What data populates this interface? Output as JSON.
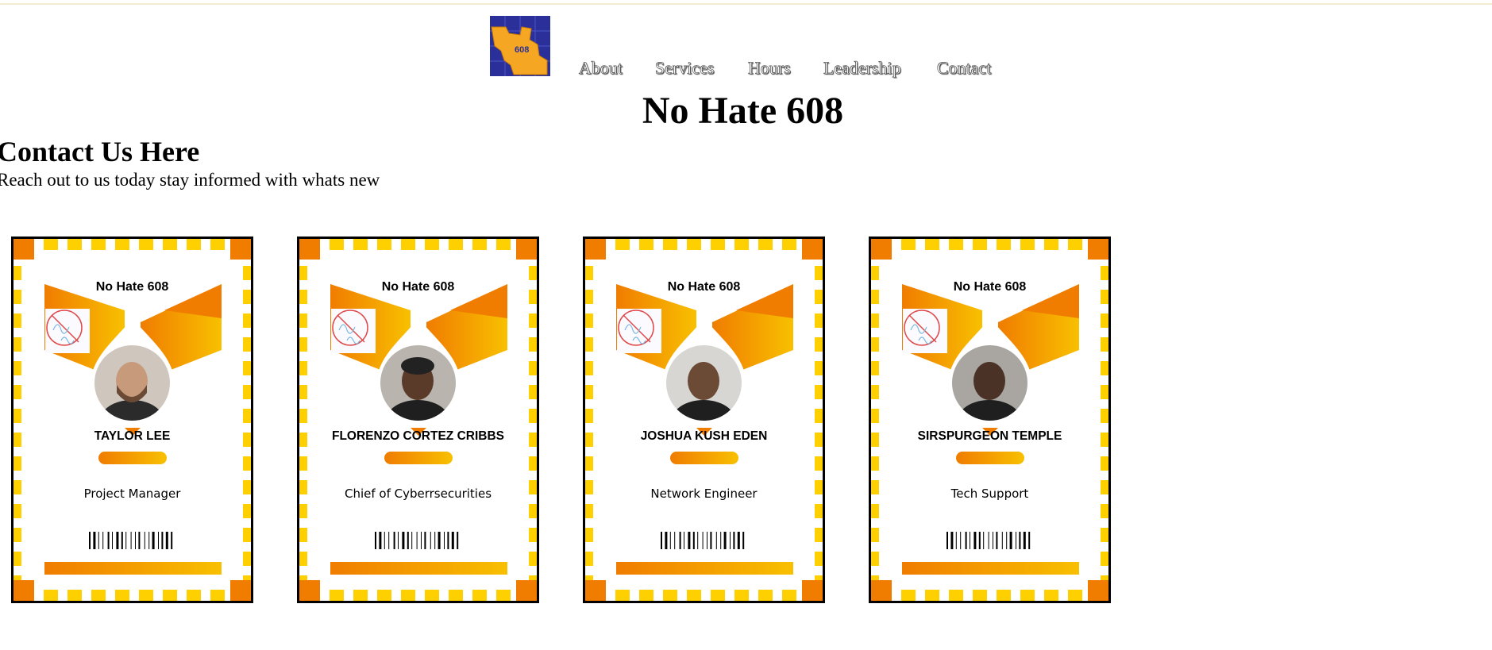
{
  "nav": {
    "logo_text": "608",
    "items": [
      "About",
      "Services",
      "Hours",
      "Leadership",
      "Contact"
    ]
  },
  "site_title": "No Hate 608",
  "contact": {
    "heading": "Contact Us Here",
    "subtext": "Reach out to us today stay informed with whats new"
  },
  "cards": [
    {
      "badge_title": "No Hate 608",
      "name": "TAYLOR LEE",
      "role": "Project Manager"
    },
    {
      "badge_title": "No Hate 608",
      "name": "FLORENZO CORTEZ CRIBBS",
      "role": "Chief of Cyberrsecurities"
    },
    {
      "badge_title": "No Hate 608",
      "name": "JOSHUA KUSH EDEN",
      "role": "Network Engineer"
    },
    {
      "badge_title": "No Hate 608",
      "name": "SIRSPURGEON TEMPLE",
      "role": "Tech Support"
    }
  ],
  "colors": {
    "frame_yellow": "#ffd000",
    "orange": "#f07c00",
    "gold": "#f8c000",
    "logo_blue": "#2b2f9a",
    "logo_orange": "#f5a623"
  }
}
